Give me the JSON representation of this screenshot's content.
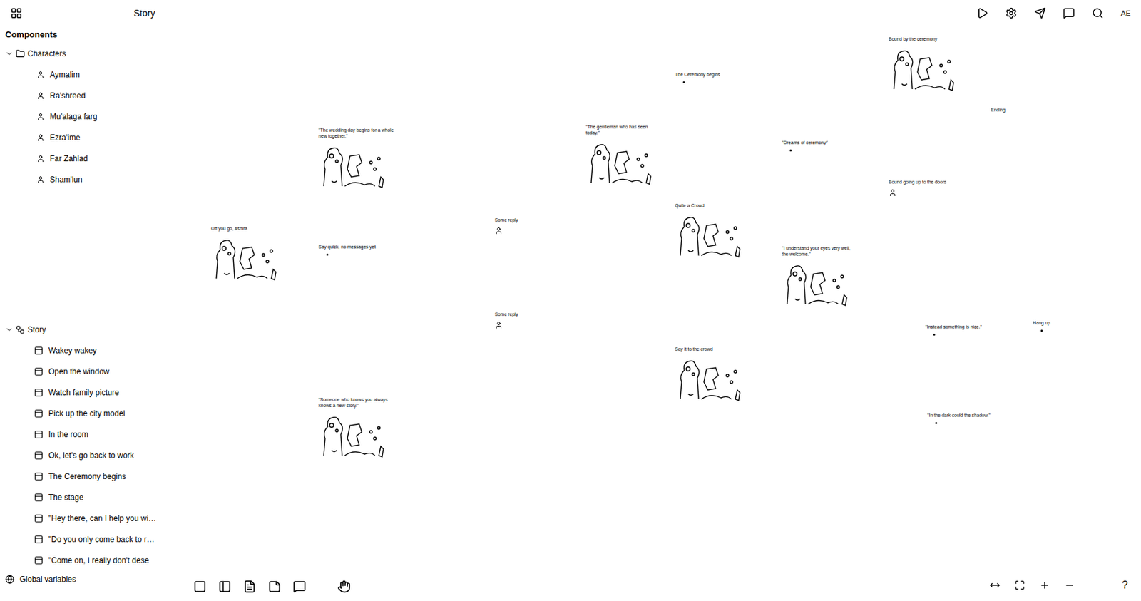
{
  "topbar": {
    "title": "Story",
    "avatar": "AE"
  },
  "sidebar": {
    "heading": "Components",
    "characters": {
      "label": "Characters",
      "expanded": true,
      "items": [
        "Aymalim",
        "Ra'shreed",
        "Mu'alaga farg",
        "Ezra'ime",
        "Far Zahlad",
        "Sham'lun"
      ]
    },
    "story": {
      "label": "Story",
      "expanded": true,
      "items": [
        "Wakey wakey",
        "Open the window",
        "Watch family picture",
        "Pick up the city model",
        "In the room",
        "Ok, let's go back to work",
        "The Ceremony begins",
        "The stage",
        "\"Hey there, can I help you wi…",
        "\"Do you only come back to r…",
        "\"Come on, I really don't dese"
      ]
    },
    "footer": "Global variables"
  },
  "canvas": {
    "nodes": [
      {
        "title": "Off you go, Ashira",
        "kind": "image"
      },
      {
        "title": "\"The wedding day begins for a whole new together.\"",
        "kind": "image"
      },
      {
        "title": "Say quick, no messages yet",
        "kind": "dot"
      },
      {
        "title": "\"Someone who knows you always knows a new story.\"",
        "kind": "image"
      },
      {
        "title": "Some reply",
        "kind": "icon"
      },
      {
        "title": "Some reply",
        "kind": "icon"
      },
      {
        "title": "\"The gentleman who has seen today.\"",
        "kind": "image"
      },
      {
        "title": "The Ceremony begins",
        "kind": "dot"
      },
      {
        "title": "Quite a Crowd",
        "kind": "image"
      },
      {
        "title": "Say it to the crowd",
        "kind": "image"
      },
      {
        "title": "\"Dreams of ceremony\"",
        "kind": "dot"
      },
      {
        "title": "\"I understand your eyes very well, the welcome.\"",
        "kind": "image"
      },
      {
        "title": "Bound by the ceremony",
        "kind": "image"
      },
      {
        "title": "Bound going up to the doors",
        "kind": "icon"
      },
      {
        "title": "\"Instead something is nice.\"",
        "kind": "dot"
      },
      {
        "title": "\"In the dark could the shadow.\"",
        "kind": "dot"
      },
      {
        "title": "Hang up",
        "kind": "dot"
      },
      {
        "title": "Ending",
        "kind": "note"
      }
    ]
  },
  "help": "?"
}
